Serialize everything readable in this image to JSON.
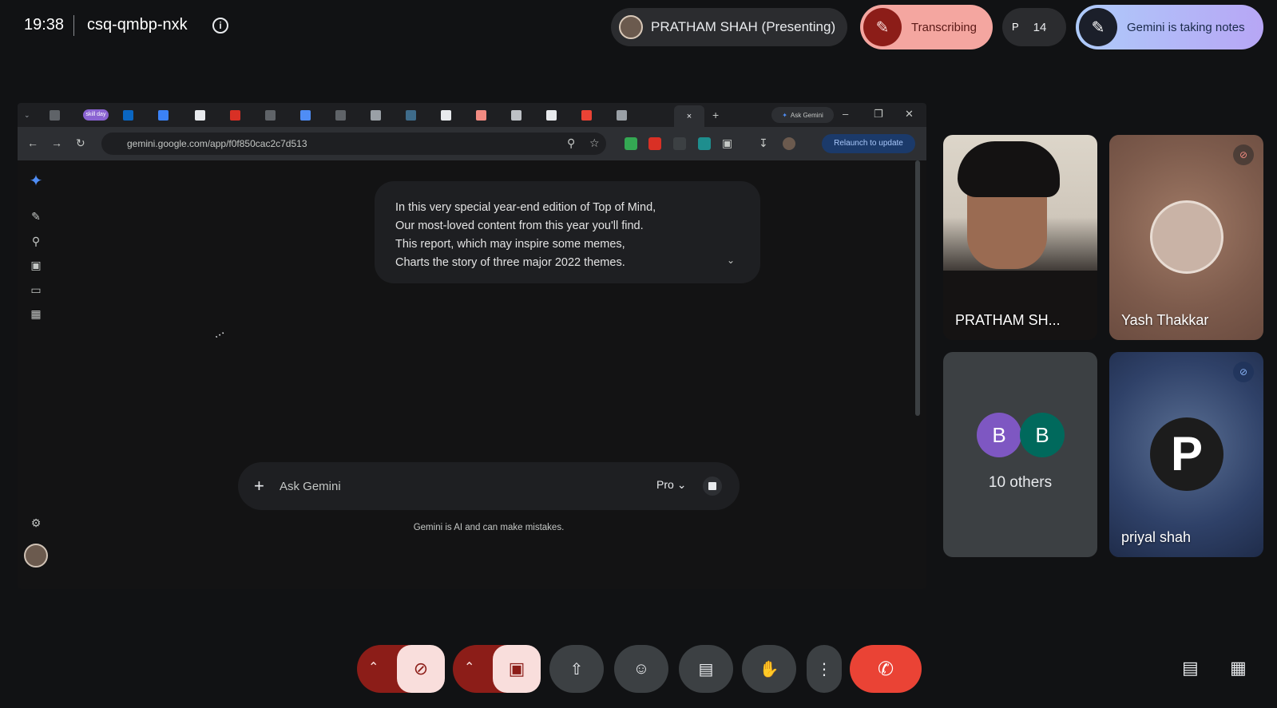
{
  "topbar": {
    "time": "19:38",
    "meeting_code": "csq-qmbp-nxk",
    "info_icon": "info-icon",
    "presenter_label": "PRATHAM SHAH (Presenting)",
    "transcribing_label": "Transcribing",
    "participants_initial": "P",
    "participant_count": "14",
    "gemini_notes_label": "Gemini is taking notes"
  },
  "browser": {
    "tab_skill_label": "skill day",
    "ask_gemini_tab": "Ask Gemini",
    "url": "gemini.google.com/app/f0f850cac2c7d513",
    "relaunch_label": "Relaunch to update",
    "message_lines": [
      "In this very special year-end edition of Top of Mind,",
      "Our most-loved content from this year you'll find.",
      "This report, which may inspire some memes,",
      "Charts the story of three major 2022 themes."
    ],
    "input_placeholder": "Ask Gemini",
    "model_label": "Pro",
    "disclaimer": "Gemini is AI and can make mistakes."
  },
  "tiles": {
    "pratham_name": "PRATHAM SH...",
    "yash_name": "Yash Thakkar",
    "others_initial_1": "B",
    "others_initial_2": "B",
    "others_label": "10 others",
    "priyal_initial": "P",
    "priyal_name": "priyal shah"
  },
  "colors": {
    "leave": "#ea4335",
    "muted_bg": "#8c1d18",
    "muted_fg": "#f9dedc"
  }
}
